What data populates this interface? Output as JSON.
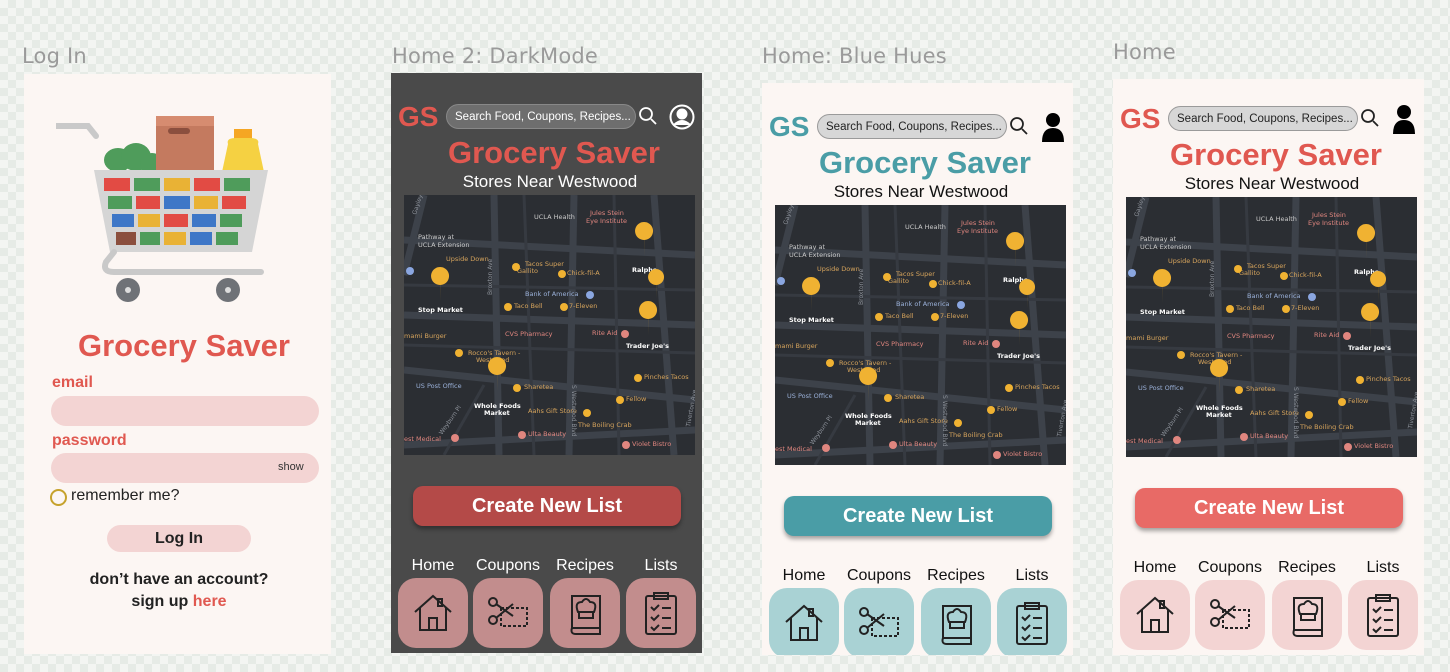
{
  "labels": {
    "login": "Log In",
    "dark": "Home 2: DarkMode",
    "blue": "Home: Blue Hues",
    "home": "Home"
  },
  "login": {
    "title": "Grocery Saver",
    "email_label": "email",
    "password_label": "password",
    "show": "show",
    "remember": "remember me?",
    "button": "Log In",
    "signup_line1": "don’t have an account?",
    "signup_prefix": "sign up",
    "signup_link": "here",
    "colors": {
      "accent": "#e05850",
      "field": "#f3d4d3",
      "bg": "#fcf6f3"
    }
  },
  "home": {
    "logo": "GS",
    "search_placeholder": "Search Food, Coupons, Recipes...",
    "title": "Grocery Saver",
    "subtitle": "Stores Near Westwood",
    "create": "Create New List",
    "nav": [
      {
        "label": "Home",
        "icon": "house-icon"
      },
      {
        "label": "Coupons",
        "icon": "scissors-coupon-icon"
      },
      {
        "label": "Recipes",
        "icon": "chef-book-icon"
      },
      {
        "label": "Lists",
        "icon": "clipboard-list-icon"
      }
    ],
    "themes": {
      "dark": {
        "bg": "#4a4a4a",
        "accent": "#e05850",
        "button": "#b44a48",
        "nav": "#c28d8d"
      },
      "blue": {
        "bg": "#fcf6f3",
        "accent": "#4a9da6",
        "button": "#4a9da6",
        "nav": "#a9d2d4"
      },
      "home": {
        "bg": "#fcf6f3",
        "accent": "#e05850",
        "button": "#e86a66",
        "nav": "#f3d4d3"
      }
    }
  },
  "map": {
    "places": [
      "UCLA Health",
      "Jules Stein Eye Institute",
      "Pathway at UCLA Extension",
      "Upside Down",
      "Tacos Super Gallito",
      "Chick-fil-A",
      "Ralphs",
      "Stop Market",
      "Bank of America",
      "Taco Bell",
      "7-Eleven",
      "CVS Pharmacy",
      "Rite Aid",
      "Trader Joe's",
      "mami Burger",
      "Rocco's Tavern - Westwood",
      "US Post Office",
      "Sharetea",
      "Pinches Tacos",
      "Whole Foods Market",
      "Aahs Gift Store",
      "Fellow",
      "The Boiling Crab",
      "Ulta Beauty",
      "Violet Bistro",
      "est Medical"
    ],
    "streets": [
      "Gayley",
      "Broxton Ave",
      "S Westwood Blvd",
      "Tiverton Ave",
      "Weyburn Pl"
    ]
  }
}
